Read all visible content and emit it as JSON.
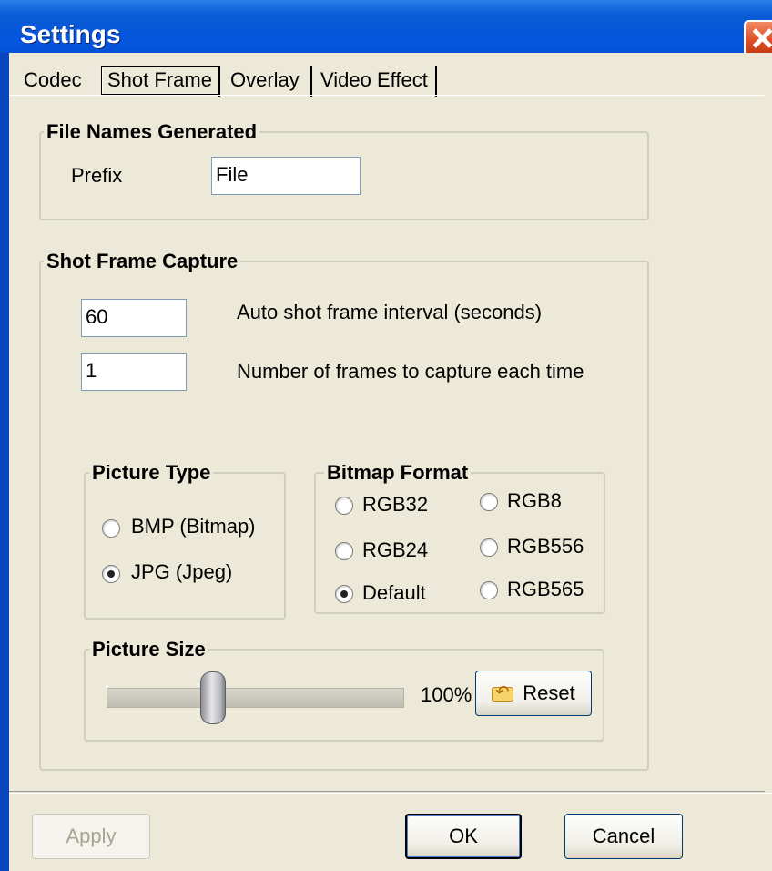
{
  "window": {
    "title": "Settings"
  },
  "tabs": [
    {
      "label": "Codec"
    },
    {
      "label": "Shot Frame"
    },
    {
      "label": "Overlay"
    },
    {
      "label": "Video Effect"
    }
  ],
  "file_names": {
    "group_label": "File Names Generated",
    "prefix_label": "Prefix",
    "prefix_value": "File"
  },
  "capture": {
    "group_label": "Shot Frame Capture",
    "interval_value": "60",
    "interval_label": "Auto shot frame interval (seconds)",
    "frames_value": "1",
    "frames_label": "Number of frames to capture each time"
  },
  "picture_type": {
    "group_label": "Picture Type",
    "options": [
      {
        "label": "BMP (Bitmap)",
        "checked": false
      },
      {
        "label": "JPG (Jpeg)",
        "checked": true
      }
    ]
  },
  "bitmap_format": {
    "group_label": "Bitmap Format",
    "options": [
      {
        "label": "RGB32",
        "checked": false
      },
      {
        "label": "RGB8",
        "checked": false
      },
      {
        "label": "RGB24",
        "checked": false
      },
      {
        "label": "RGB556",
        "checked": false
      },
      {
        "label": "Default",
        "checked": true
      },
      {
        "label": "RGB565",
        "checked": false
      }
    ]
  },
  "picture_size": {
    "group_label": "Picture Size",
    "value_text": "100%",
    "slider_fraction": 0.38,
    "reset_label": "Reset"
  },
  "footer": {
    "apply_label": "Apply",
    "ok_label": "OK",
    "cancel_label": "Cancel"
  },
  "colors": {
    "titlebar": "#0554dd",
    "dialog_bg": "#ece9d8",
    "close_button": "#dd4b23"
  },
  "icons": [
    "close-icon",
    "reset-icon"
  ]
}
